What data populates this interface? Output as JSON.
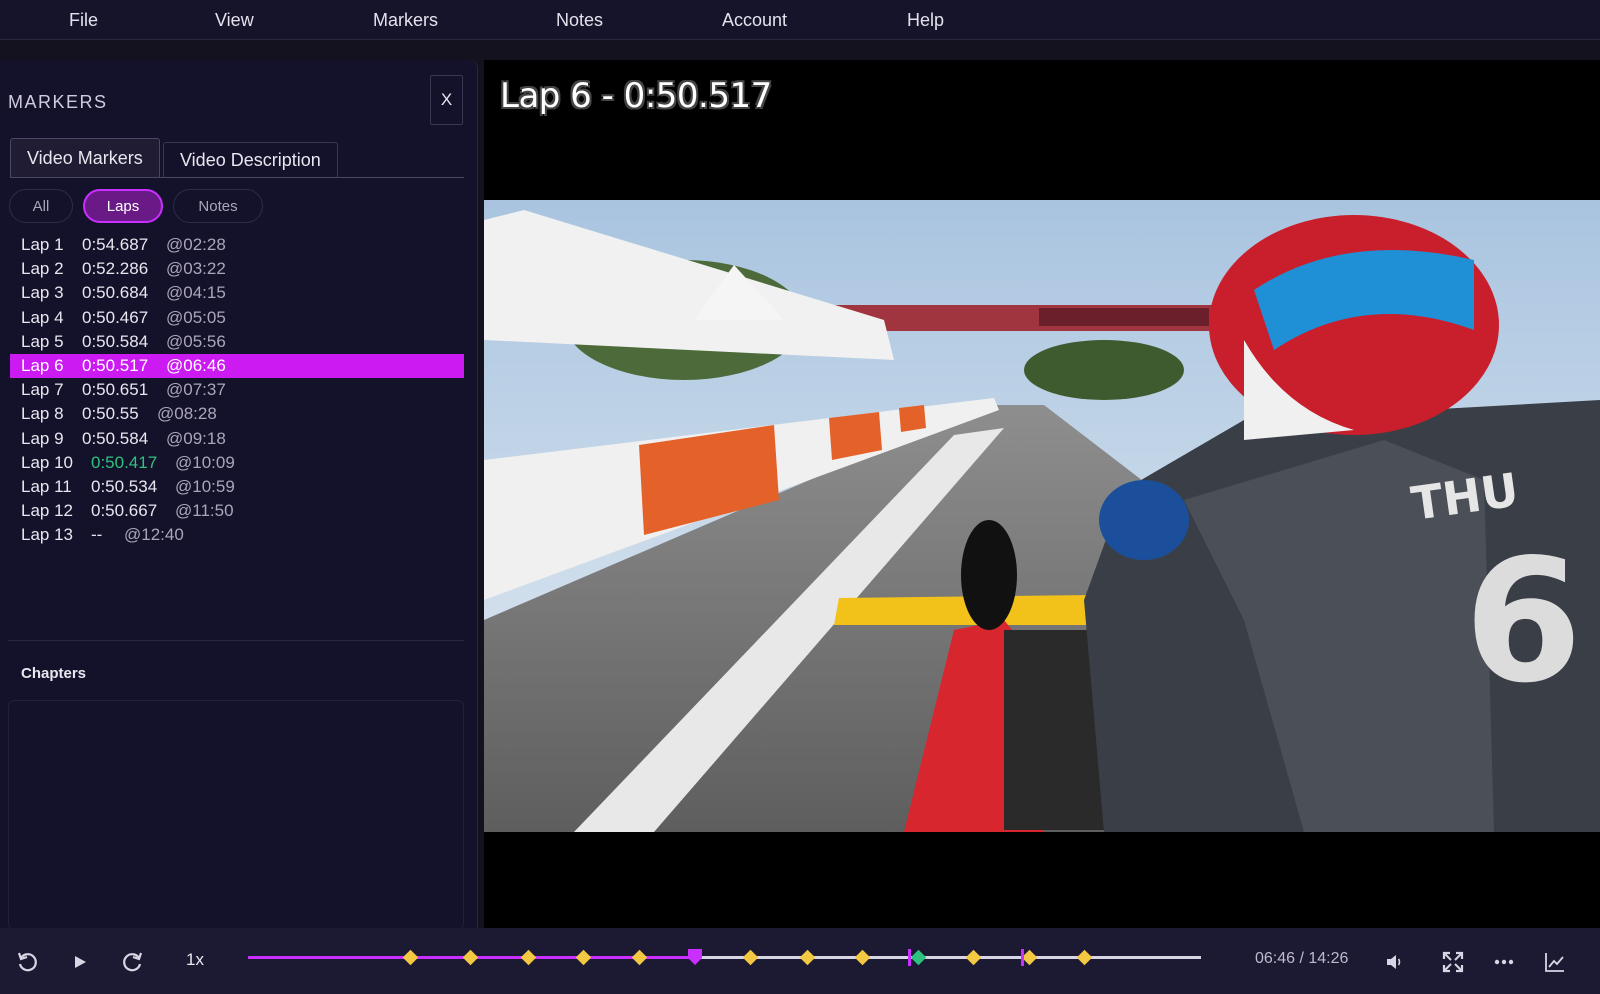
{
  "menu": [
    "File",
    "View",
    "Markers",
    "Notes",
    "Account",
    "Help"
  ],
  "sidebar": {
    "title": "MARKERS",
    "close_label": "X",
    "tabs": [
      "Video Markers",
      "Video Description"
    ],
    "filters": [
      "All",
      "Laps",
      "Notes"
    ],
    "laps": [
      {
        "label": "Lap 1",
        "time": "0:54.687",
        "at": "@02:28"
      },
      {
        "label": "Lap 2",
        "time": "0:52.286",
        "at": "@03:22"
      },
      {
        "label": "Lap 3",
        "time": "0:50.684",
        "at": "@04:15"
      },
      {
        "label": "Lap 4",
        "time": "0:50.467",
        "at": "@05:05"
      },
      {
        "label": "Lap 5",
        "time": "0:50.584",
        "at": "@05:56"
      },
      {
        "label": "Lap 6",
        "time": "0:50.517",
        "at": "@06:46"
      },
      {
        "label": "Lap 7",
        "time": "0:50.651",
        "at": "@07:37"
      },
      {
        "label": "Lap 8",
        "time": "0:50.55",
        "at": "@08:28"
      },
      {
        "label": "Lap 9",
        "time": "0:50.584",
        "at": "@09:18"
      },
      {
        "label": "Lap 10",
        "time": "0:50.417",
        "at": "@10:09"
      },
      {
        "label": "Lap 11",
        "time": "0:50.534",
        "at": "@10:59"
      },
      {
        "label": "Lap 12",
        "time": "0:50.667",
        "at": "@11:50"
      },
      {
        "label": "Lap 13",
        "time": "--",
        "at": "@12:40"
      }
    ],
    "selected_lap_index": 5,
    "best_lap_index": 9,
    "chapters_label": "Chapters"
  },
  "video": {
    "overlay_title": "Lap 6 - 0:50.517"
  },
  "player": {
    "speed": "1x",
    "time": "06:46 / 14:26",
    "progress_seconds": 406,
    "duration_seconds": 866,
    "accent_color": "#c930ff",
    "lap_marker_color": "#f3c842",
    "best_lap_marker_color": "#2ec27e",
    "icons": [
      "rewind-icon",
      "play-icon",
      "forward-icon",
      "volume-icon",
      "fullscreen-icon",
      "more-icon",
      "chart-icon"
    ]
  }
}
